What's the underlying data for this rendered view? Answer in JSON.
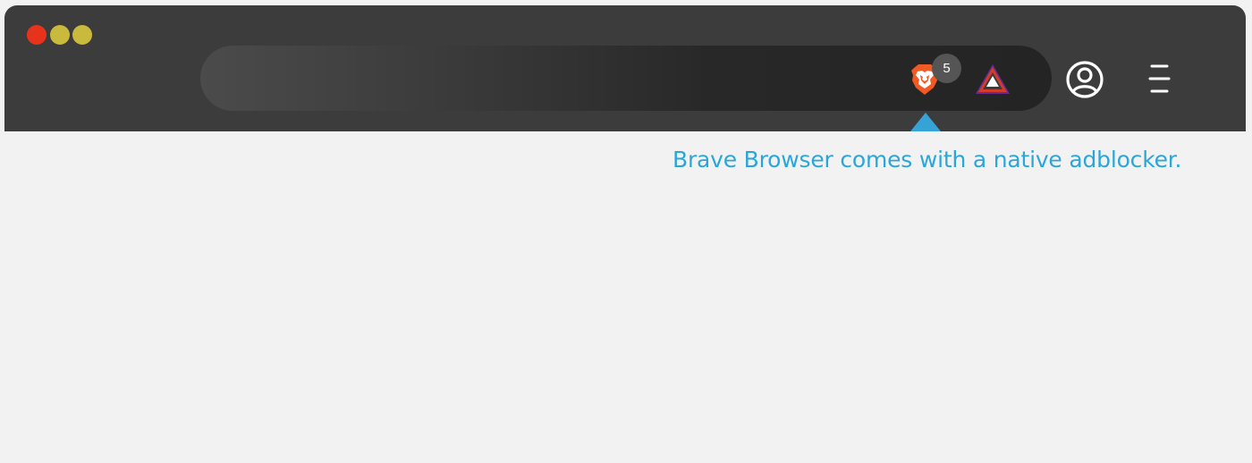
{
  "window": {
    "controls": [
      "close",
      "minimize",
      "maximize"
    ],
    "control_colors": {
      "close": "#e8331c",
      "minimize": "#c9b93d",
      "maximize": "#c9b93d"
    }
  },
  "toolbar": {
    "background": "#3c3c3c",
    "shields": {
      "icon": "brave-lion-shield-icon",
      "badge_count": "5",
      "color": "#f15a22"
    },
    "rewards": {
      "icon": "brave-rewards-triangle-icon"
    },
    "profile": {
      "icon": "profile-icon"
    },
    "menu": {
      "icon": "hamburger-menu-icon"
    }
  },
  "callout": {
    "text": "Brave Browser comes with a native adblocker.",
    "color": "#2ba6d9"
  }
}
